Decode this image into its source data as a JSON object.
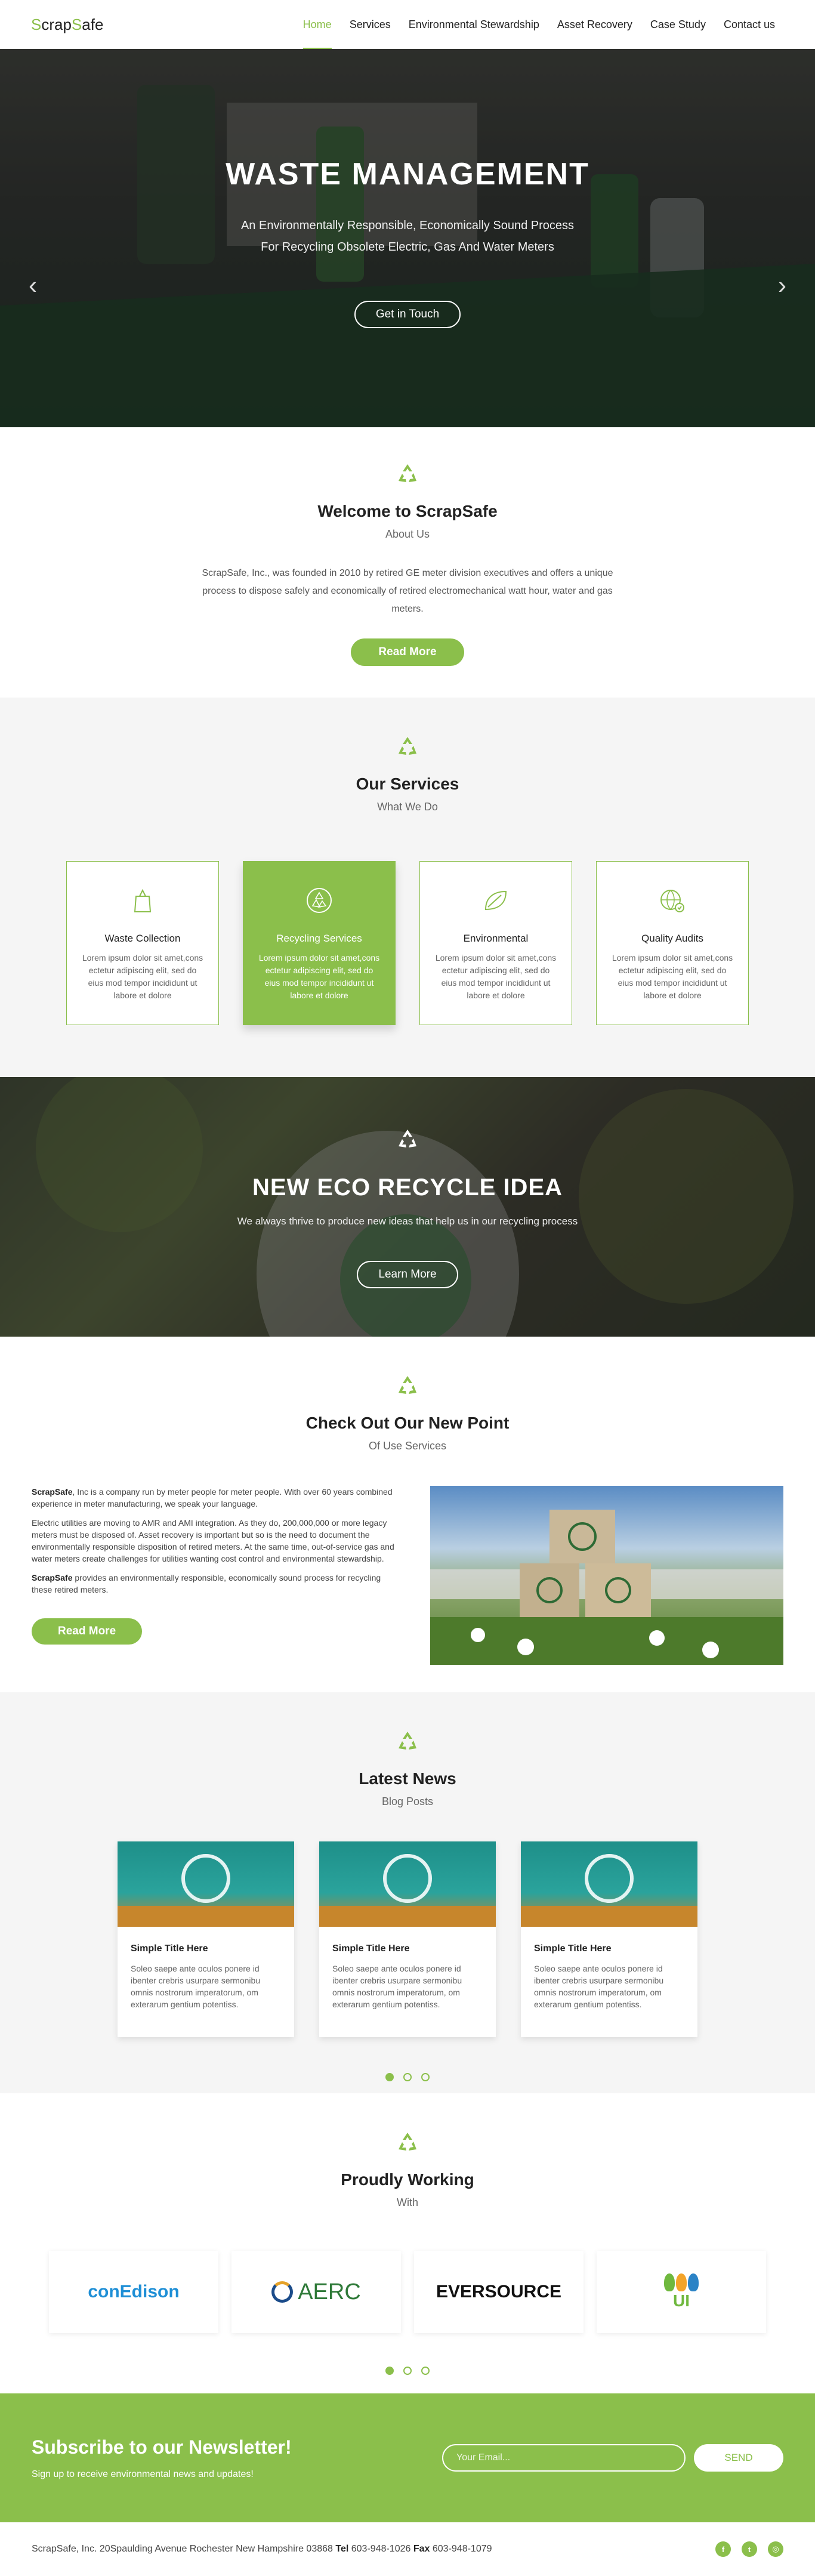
{
  "brand": {
    "logo_first": "S",
    "logo_mid": "crap",
    "logo_s": "S",
    "logo_end": "afe",
    "accent": "#8bbf4b"
  },
  "nav": {
    "items": [
      "Home",
      "Services",
      "Environmental Stewardship",
      "Asset Recovery",
      "Case Study",
      "Contact us"
    ],
    "active": "Home"
  },
  "hero": {
    "title": "WASTE MANAGEMENT",
    "line1": "An Environmentally Responsible, Economically Sound Process",
    "line2": "For Recycling Obsolete Electric, Gas And Water Meters",
    "cta": "Get in Touch",
    "prev_icon": "chevron-left-icon",
    "next_icon": "chevron-right-icon"
  },
  "welcome": {
    "title": "Welcome to ScrapSafe",
    "subtitle": "About Us",
    "text": "ScrapSafe, Inc., was founded in 2010 by retired GE meter division executives and offers a unique process to dispose safely and economically of retired electromechanical watt hour, water and gas meters.",
    "cta": "Read More"
  },
  "services": {
    "title": "Our Services",
    "subtitle": "What We Do",
    "cards": [
      {
        "title": "Waste Collection",
        "text": "Lorem ipsum dolor sit amet,cons ectetur adipiscing elit, sed do eius mod tempor incididunt ut labore et dolore",
        "icon": "trash-bag-icon"
      },
      {
        "title": "Recycling Services",
        "text": "Lorem ipsum dolor sit amet,cons ectetur adipiscing elit, sed do eius mod tempor incididunt ut labore et dolore",
        "icon": "recycle-sphere-icon"
      },
      {
        "title": "Environmental",
        "text": "Lorem ipsum dolor sit amet,cons ectetur adipiscing elit, sed do eius mod tempor incididunt ut labore et dolore",
        "icon": "leaf-icon"
      },
      {
        "title": "Quality Audits",
        "text": "Lorem ipsum dolor sit amet,cons ectetur adipiscing elit, sed do eius mod tempor incididunt ut labore et dolore",
        "icon": "globe-check-icon"
      }
    ]
  },
  "eco": {
    "title": "NEW ECO RECYCLE IDEA",
    "text": "We always thrive to produce new ideas that help us in our recycling process",
    "cta": "Learn More"
  },
  "point": {
    "title": "Check Out Our New Point",
    "subtitle": "Of Use Services",
    "p1_bold": "ScrapSafe",
    "p1": ", Inc is a company run by meter people for meter people.  With over 60 years combined experience in meter manufacturing, we speak your language.",
    "p2": "Electric utilities are moving to AMR and AMI integration.  As they do, 200,000,000 or more legacy meters must be disposed of.  Asset recovery is important but so is the need to document the environmentally responsible disposition of retired meters. At the same time, out-of-service gas and water meters create challenges for utilities wanting cost control and environmental stewardship.",
    "p3_bold": "ScrapSafe",
    "p3": " provides an environmentally responsible, economically sound process for recycling these retired meters.",
    "cta": "Read More"
  },
  "news": {
    "title": "Latest News",
    "subtitle": "Blog Posts",
    "posts": [
      {
        "title": "Simple Title Here",
        "text": "Soleo saepe ante oculos ponere id ibenter crebris usurpare sermonibu omnis nostrorum imperatorum, om exterarum gentium potentiss."
      },
      {
        "title": "Simple Title Here",
        "text": "Soleo saepe ante oculos ponere id ibenter crebris usurpare sermonibu omnis nostrorum imperatorum, om exterarum gentium potentiss."
      },
      {
        "title": "Simple Title Here",
        "text": "Soleo saepe ante oculos ponere id ibenter crebris usurpare sermonibu omnis nostrorum imperatorum, om exterarum gentium potentiss."
      }
    ]
  },
  "partners": {
    "title": "Proudly Working",
    "subtitle": "With",
    "logos": [
      "conEdison",
      "AERC",
      "EVERSOURCE",
      "UI"
    ]
  },
  "newsletter": {
    "title": "Subscribe to our Newsletter!",
    "text": "Sign up to receive environmental news and updates!",
    "placeholder": "Your Email...",
    "send": "SEND"
  },
  "footer": {
    "address": "ScrapSafe, Inc. 20Spaulding Avenue Rochester New Hampshire 03868",
    "tel_label": "Tel",
    "tel": "603-948-1026",
    "fax_label": "Fax",
    "fax": "603-948-1079",
    "social": [
      "facebook-icon",
      "twitter-icon",
      "instagram-icon"
    ]
  }
}
